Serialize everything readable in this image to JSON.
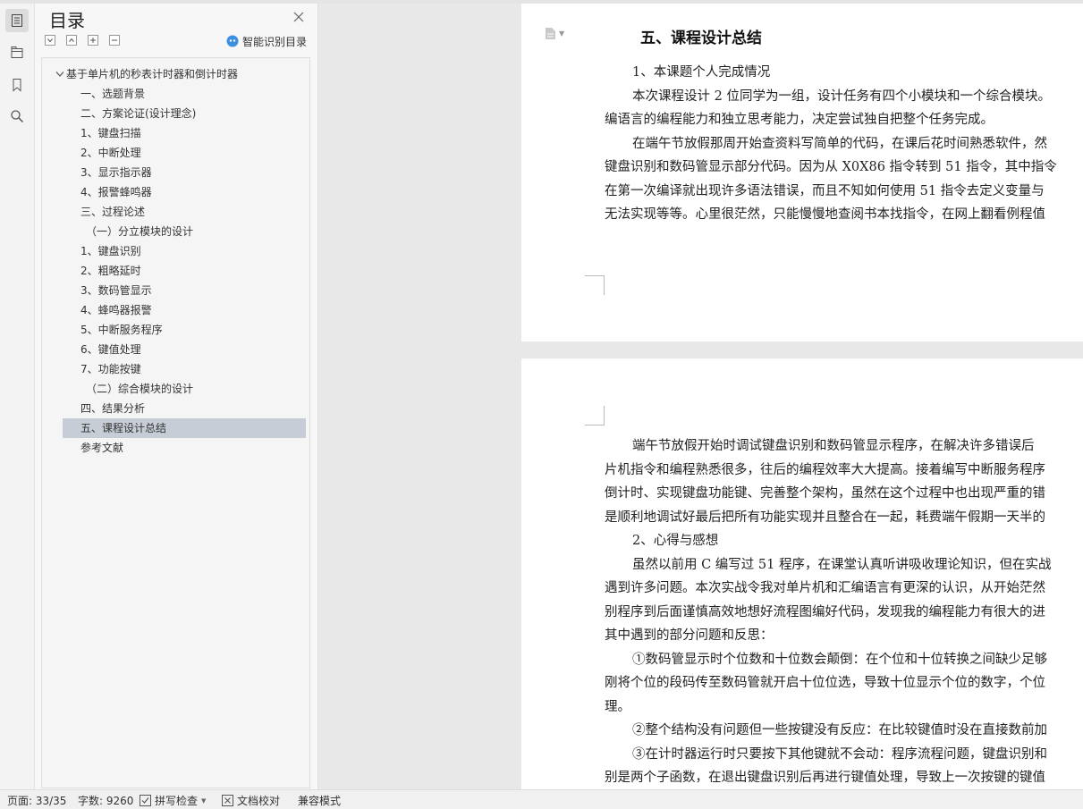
{
  "toc": {
    "title": "目录",
    "smart_label": "智能识别目录",
    "root": "基于单片机的秒表计时器和倒计时器",
    "items": [
      {
        "label": "一、选题背景",
        "level": "item"
      },
      {
        "label": "二、方案论证(设计理念)",
        "level": "item"
      },
      {
        "label": "1、键盘扫描",
        "level": "item"
      },
      {
        "label": "2、中断处理",
        "level": "item"
      },
      {
        "label": "3、显示指示器",
        "level": "item"
      },
      {
        "label": "4、报警蜂鸣器",
        "level": "item"
      },
      {
        "label": "三、过程论述",
        "level": "item"
      },
      {
        "label": "（一）分立模块的设计",
        "level": "sub"
      },
      {
        "label": "1、键盘识别",
        "level": "item"
      },
      {
        "label": "2、粗略延时",
        "level": "item"
      },
      {
        "label": "3、数码管显示",
        "level": "item"
      },
      {
        "label": "4、蜂鸣器报警",
        "level": "item"
      },
      {
        "label": "5、中断服务程序",
        "level": "item"
      },
      {
        "label": "6、键值处理",
        "level": "item"
      },
      {
        "label": "7、功能按键",
        "level": "item"
      },
      {
        "label": "（二）综合模块的设计",
        "level": "sub"
      },
      {
        "label": "四、结果分析",
        "level": "item"
      },
      {
        "label": "五、课程设计总结",
        "level": "item",
        "selected": true
      },
      {
        "label": "参考文献",
        "level": "item"
      }
    ]
  },
  "document": {
    "heading": "五、课程设计总结",
    "page1_lines": [
      {
        "text": "1、本课题个人完成情况",
        "indent": true
      },
      {
        "text": "本次课程设计 2 位同学为一组，设计任务有四个小模块和一个综合模块。",
        "indent": true
      },
      {
        "text": "编语言的编程能力和独立思考能力，决定尝试独自把整个任务完成。",
        "indent": false
      },
      {
        "text": "在端午节放假那周开始查资料写简单的代码，在课后花时间熟悉软件，然",
        "indent": true
      },
      {
        "text": "键盘识别和数码管显示部分代码。因为从 X0X86 指令转到 51 指令，其中指令",
        "indent": false
      },
      {
        "text": "在第一次编译就出现许多语法错误，而且不知如何使用 51 指令去定义变量与",
        "indent": false
      },
      {
        "text": "无法实现等等。心里很茫然，只能慢慢地查阅书本找指令，在网上翻看例程值",
        "indent": false
      }
    ],
    "page2_lines": [
      {
        "text": "端午节放假开始时调试键盘识别和数码管显示程序，在解决许多错误后",
        "indent": true
      },
      {
        "text": "片机指令和编程熟悉很多，往后的编程效率大大提高。接着编写中断服务程序",
        "indent": false
      },
      {
        "text": "倒计时、实现键盘功能键、完善整个架构，虽然在这个过程中也出现严重的错",
        "indent": false
      },
      {
        "text": "是顺利地调试好最后把所有功能实现并且整合在一起，耗费端午假期一天半的",
        "indent": false
      },
      {
        "text": "2、心得与感想",
        "indent": true
      },
      {
        "text": "虽然以前用 C 编写过 51 程序，在课堂认真听讲吸收理论知识，但在实战",
        "indent": true
      },
      {
        "text": "遇到许多问题。本次实战令我对单片机和汇编语言有更深的认识，从开始茫然",
        "indent": false
      },
      {
        "text": "别程序到后面谨慎高效地想好流程图编好代码，发现我的编程能力有很大的进",
        "indent": false
      },
      {
        "text": "其中遇到的部分问题和反思：",
        "indent": false
      },
      {
        "text": "①数码管显示时个位数和十位数会颠倒：在个位和十位转换之间缺少足够",
        "indent": true
      },
      {
        "text": "刚将个位的段码传至数码管就开启十位位选，导致十位显示个位的数字，个位",
        "indent": false
      },
      {
        "text": "理。",
        "indent": false
      },
      {
        "text": "②整个结构没有问题但一些按键没有反应：在比较键值时没在直接数前加",
        "indent": true
      },
      {
        "text": "③在计时器运行时只要按下其他键就不会动：程序流程问题，键盘识别和",
        "indent": true
      },
      {
        "text": "别是两个子函数，在退出键盘识别后再进行键值处理，导致上一次按键的键值",
        "indent": false
      }
    ]
  },
  "status": {
    "page": "页面: 33/35",
    "words": "字数: 9260",
    "spell": "拼写检查",
    "proof": "文档校对",
    "compat": "兼容模式"
  },
  "colors": {
    "selected_row": "#c7cdd6",
    "smart_icon": "#3d8fe0"
  }
}
